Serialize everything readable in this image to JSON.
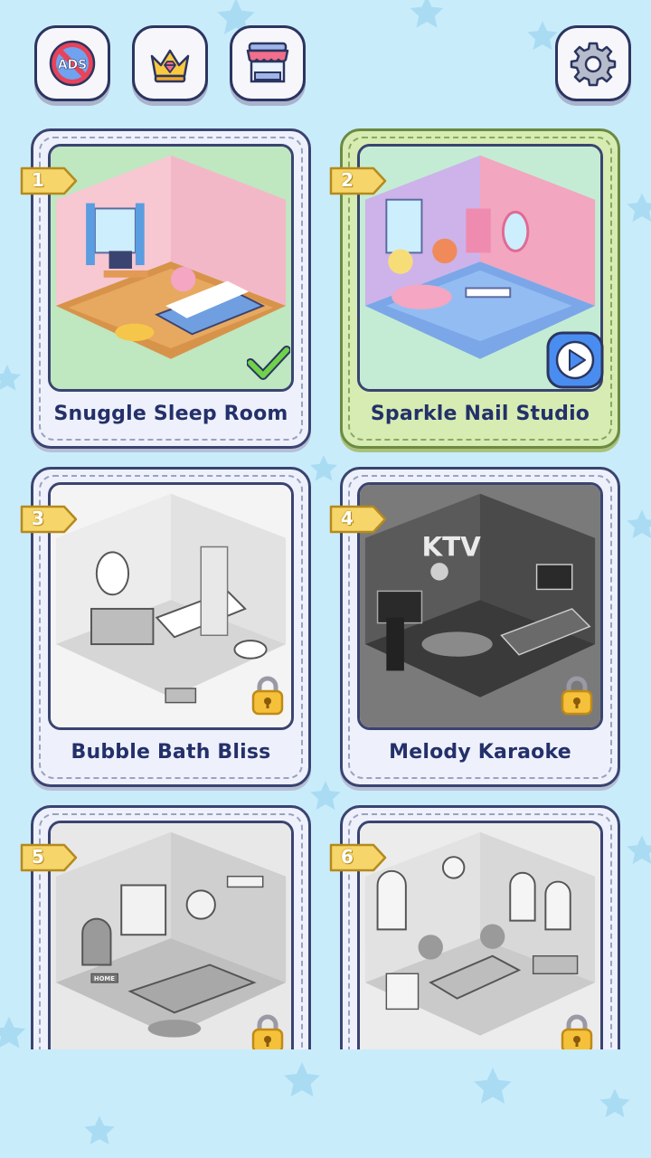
{
  "toolbar": {
    "no_ads_label": "ADS",
    "no_ads_icon": "no-ads-icon",
    "vip_icon": "crown-diamond-icon",
    "shop_icon": "shop-icon",
    "settings_icon": "gear-icon"
  },
  "levels": [
    {
      "number": "1",
      "title": "Snuggle Sleep Room",
      "status": "completed",
      "badge_icon": "checkmark-icon"
    },
    {
      "number": "2",
      "title": "Sparkle Nail Studio",
      "status": "current",
      "badge_icon": "play-icon"
    },
    {
      "number": "3",
      "title": "Bubble Bath Bliss",
      "status": "locked",
      "badge_icon": "lock-icon"
    },
    {
      "number": "4",
      "title": "Melody Karaoke",
      "status": "locked",
      "badge_icon": "lock-icon",
      "sign": "KTV"
    },
    {
      "number": "5",
      "title": "",
      "status": "locked",
      "badge_icon": "lock-icon",
      "sign": "HOME"
    },
    {
      "number": "6",
      "title": "",
      "status": "locked",
      "badge_icon": "lock-icon"
    }
  ],
  "colors": {
    "background": "#c9ecfb",
    "card_border": "#3a4470",
    "active_card": "#d6ecb2",
    "tag_yellow": "#f6d66a",
    "title_text": "#24306a"
  }
}
